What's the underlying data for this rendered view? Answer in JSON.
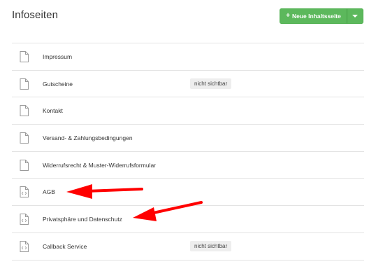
{
  "header": {
    "title": "Infoseiten",
    "new_button_label": "Neue Inhaltsseite",
    "new_button_icon": "plus-icon",
    "dropdown_icon": "caret-down-icon"
  },
  "pages": [
    {
      "label": "Impressum",
      "icon": "page-icon",
      "badge": ""
    },
    {
      "label": "Gutscheine",
      "icon": "page-icon",
      "badge": "nicht sichtbar"
    },
    {
      "label": "Kontakt",
      "icon": "page-icon",
      "badge": ""
    },
    {
      "label": "Versand- & Zahlungsbedingungen",
      "icon": "page-icon",
      "badge": ""
    },
    {
      "label": "Widerrufsrecht & Muster-Widerrufsformular",
      "icon": "page-icon",
      "badge": ""
    },
    {
      "label": "AGB",
      "icon": "code-page-icon",
      "badge": ""
    },
    {
      "label": "Privatsphäre und Datenschutz",
      "icon": "code-page-icon",
      "badge": ""
    },
    {
      "label": "Callback Service",
      "icon": "code-page-icon",
      "badge": "nicht sichtbar"
    }
  ],
  "colors": {
    "button": "#5cb85c",
    "annotation_arrow": "#ff0000",
    "badge_bg": "#eeeeee",
    "divider": "#e3e3e3"
  }
}
